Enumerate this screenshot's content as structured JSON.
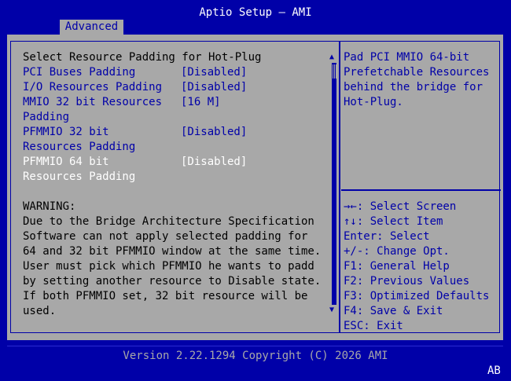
{
  "header": {
    "title": "Aptio Setup – AMI"
  },
  "tabs": [
    {
      "label": "Advanced"
    }
  ],
  "settings": {
    "section_title": "Select Resource Padding for Hot-Plug",
    "items": [
      {
        "label": [
          "PCI Buses Padding"
        ],
        "value": "[Disabled]"
      },
      {
        "label": [
          "I/O Resources Padding"
        ],
        "value": "[Disabled]"
      },
      {
        "label": [
          "MMIO 32 bit Resources",
          "Padding"
        ],
        "value": "[16 M]"
      },
      {
        "label": [
          "PFMMIO 32 bit",
          "Resources Padding"
        ],
        "value": "[Disabled]"
      },
      {
        "label": [
          "PFMMIO 64 bit",
          "Resources Padding"
        ],
        "value": "[Disabled]"
      }
    ],
    "warning": [
      "WARNING:",
      "Due to the Bridge Architecture Specification",
      "Software can not apply selected padding for",
      "64 and 32 bit PFMMIO window at the same time.",
      "User must pick which PFMMIO he wants to padd",
      "by setting another resource to Disable state.",
      "If both PFMMIO set, 32 bit resource will be",
      "used."
    ]
  },
  "help": {
    "description": [
      "Pad PCI MMIO 64-bit",
      "Prefetchable Resources",
      "behind the bridge for",
      "Hot-Plug."
    ],
    "keys": [
      "→←: Select Screen",
      "↑↓: Select Item",
      "Enter: Select",
      "+/-: Change Opt.",
      "F1: General Help",
      "F2: Previous Values",
      "F3: Optimized Defaults",
      "F4: Save & Exit",
      "ESC: Exit"
    ]
  },
  "scrollbar": {
    "up_arrow": "▲",
    "down_arrow": "▼"
  },
  "footer": {
    "version": "Version 2.22.1294 Copyright (C) 2026 AMI",
    "badge": "AB"
  },
  "colors": {
    "background": "#0000a8",
    "panel": "#a8a8a8",
    "item_text": "#0000a8",
    "selected_text": "#ffffff",
    "static_text": "#000000"
  }
}
